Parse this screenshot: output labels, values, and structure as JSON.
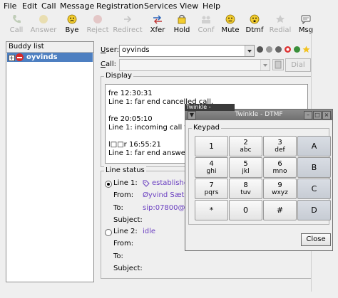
{
  "menu": [
    "File",
    "Edit",
    "Call",
    "Message",
    "Registration",
    "Services",
    "View",
    "Help"
  ],
  "toolbar": [
    {
      "label": "Call",
      "enabled": false,
      "icon": "phone-call-icon"
    },
    {
      "label": "Answer",
      "enabled": false,
      "icon": "phone-answer-icon"
    },
    {
      "label": "Bye",
      "enabled": true,
      "icon": "hangup-face-icon"
    },
    {
      "label": "Reject",
      "enabled": false,
      "icon": "reject-icon"
    },
    {
      "label": "Redirect",
      "enabled": false,
      "icon": "redirect-icon"
    },
    {
      "label": "Xfer",
      "enabled": true,
      "icon": "transfer-icon"
    },
    {
      "label": "Hold",
      "enabled": true,
      "icon": "hold-icon"
    },
    {
      "label": "Conf",
      "enabled": false,
      "icon": "conference-icon"
    },
    {
      "label": "Mute",
      "enabled": true,
      "icon": "mute-icon"
    },
    {
      "label": "Dtmf",
      "enabled": true,
      "icon": "dtmf-icon"
    },
    {
      "label": "Redial",
      "enabled": false,
      "icon": "redial-icon"
    },
    {
      "label": "Msg",
      "enabled": true,
      "icon": "message-icon"
    }
  ],
  "buddy_list": {
    "header": "Buddy list",
    "items": [
      {
        "name": "oyvinds",
        "expander": "+",
        "status_icon": "offline-status-icon"
      }
    ]
  },
  "user": {
    "label": "User:",
    "value": "oyvinds"
  },
  "call": {
    "label": "Call:",
    "value": "",
    "dial_label": "Dial"
  },
  "display": {
    "title": "Display",
    "lines": [
      "fre 12:30:31",
      "Line 1: far end cancelled call.",
      "",
      "fre 20:05:10",
      "Line 1: incoming call for s",
      "",
      "l□□r 16:55:21",
      "Line 1: far end answered"
    ]
  },
  "line_status": {
    "title": "Line status",
    "lines": [
      {
        "label": "Line 1:",
        "selected": true,
        "state": "established",
        "from_label": "From:",
        "from": "Øyvind Sæthe",
        "to_label": "To:",
        "to": "sip:07800@kr",
        "subject_label": "Subject:",
        "subject": ""
      },
      {
        "label": "Line 2:",
        "selected": false,
        "state": "idle",
        "from_label": "From:",
        "from": "",
        "to_label": "To:",
        "to": "",
        "subject_label": "Subject:",
        "subject": ""
      }
    ]
  },
  "dtmf": {
    "tooltip": "Twinkle - ",
    "title": "Twinkle - DTMF",
    "group_title": "Keypad",
    "keys": [
      {
        "digit": "1",
        "letters": ""
      },
      {
        "digit": "2",
        "letters": "abc"
      },
      {
        "digit": "3",
        "letters": "def"
      },
      {
        "digit": "A",
        "letters": ""
      },
      {
        "digit": "4",
        "letters": "ghi"
      },
      {
        "digit": "5",
        "letters": "jkl"
      },
      {
        "digit": "6",
        "letters": "mno"
      },
      {
        "digit": "B",
        "letters": ""
      },
      {
        "digit": "7",
        "letters": "pqrs"
      },
      {
        "digit": "8",
        "letters": "tuv"
      },
      {
        "digit": "9",
        "letters": "wxyz"
      },
      {
        "digit": "C",
        "letters": ""
      },
      {
        "digit": "*",
        "letters": ""
      },
      {
        "digit": "0",
        "letters": ""
      },
      {
        "digit": "#",
        "letters": ""
      },
      {
        "digit": "D",
        "letters": ""
      }
    ],
    "close_label": "Close"
  }
}
